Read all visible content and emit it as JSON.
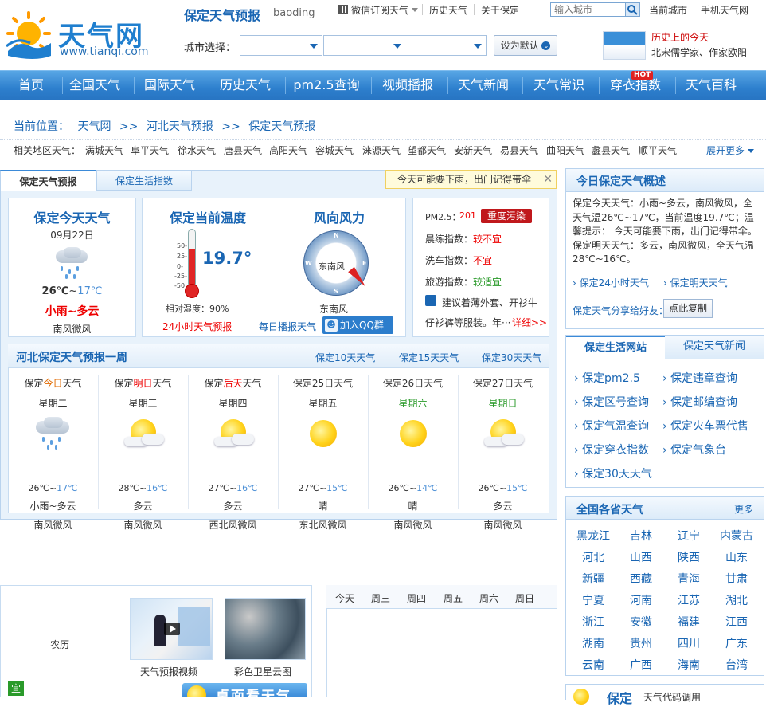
{
  "header": {
    "logo_text": "天气网",
    "logo_url": "www.tianqi.com",
    "page_title": "保定天气预报",
    "page_title_en": "baoding",
    "top_links": [
      "微信订阅天气",
      "历史天气",
      "关于保定"
    ],
    "search_placeholder": "输入城市",
    "current_city": "当前城市",
    "mobile_weather": "手机天气网",
    "city_select_label": "城市选择：",
    "set_default": "设为默认",
    "history_today_title": "历史上的今天",
    "history_today_desc": "北宋儒学家、作家欧阳"
  },
  "nav": {
    "items": [
      "首页",
      "全国天气",
      "国际天气",
      "历史天气",
      "pm2.5查询",
      "视频播报",
      "天气新闻",
      "天气常识",
      "穿衣指数",
      "天气百科"
    ],
    "hot_badge": "HOT"
  },
  "breadcrumb": {
    "label": "当前位置：",
    "items": [
      "天气网",
      "河北天气预报",
      "保定天气预报"
    ],
    "sep": ">>"
  },
  "related": {
    "label": "相关地区天气：",
    "items": [
      "满城天气",
      "阜平天气",
      "徐水天气",
      "唐县天气",
      "高阳天气",
      "容城天气",
      "涞源天气",
      "望都天气",
      "安新天气",
      "易县天气",
      "曲阳天气",
      "蠡县天气",
      "顺平天气"
    ],
    "expand": "展开更多"
  },
  "tabs": {
    "forecast": "保定天气预报",
    "life": "保定生活指数"
  },
  "alert": "今天可能要下雨，出门记得带伞",
  "today": {
    "title": "保定今天天气",
    "date": "09月22日",
    "temp_high": "26℃",
    "tilde": "~",
    "temp_low": "17℃",
    "condition": "小雨~多云",
    "wind": "南风微风"
  },
  "current": {
    "title": "保定当前温度",
    "temp": "19.7°",
    "temp_fraction": 0.66,
    "ticks": [
      "50-",
      "25-",
      "0-",
      "-25-",
      "-50"
    ],
    "humidity": "相对湿度：90%",
    "hourly_link": "24小时天气预报",
    "wind_title": "风向风力",
    "wind_dir": "东南风",
    "wind_bottom": "东南风",
    "compass": [
      "N",
      "E",
      "S",
      "W"
    ],
    "broadcast": "每日播报天气",
    "qq_group": "加入QQ群"
  },
  "indices": {
    "pm25_label": "PM2.5：",
    "pm25_value": "201",
    "pm25_level": "重度污染",
    "items": [
      {
        "label": "晨练指数：",
        "value": "较不宜"
      },
      {
        "label": "洗车指数：",
        "value": "不宜"
      },
      {
        "label": "旅游指数：",
        "value": "较适宜"
      }
    ],
    "advice_line1": "建议着薄外套、开衫牛",
    "advice_line2": "仔衫裤等服装。年···",
    "detail": "详细>>"
  },
  "week": {
    "title": "河北保定天气预报一周",
    "links": [
      "保定10天天气",
      "保定15天天气",
      "保定30天天气"
    ],
    "days": [
      {
        "pre": "保定",
        "hl": "今日",
        "post": "天气",
        "hl_class": "orange",
        "weekday": "星期二",
        "wk_class": "",
        "high": "26℃",
        "low": "17℃",
        "cond": "小雨~多云",
        "wind": "南风微风",
        "icon": "rain"
      },
      {
        "pre": "保定",
        "hl": "明日",
        "post": "天气",
        "hl_class": "red",
        "weekday": "星期三",
        "wk_class": "",
        "high": "28℃",
        "low": "16℃",
        "cond": "多云",
        "wind": "南风微风",
        "icon": "cloudy"
      },
      {
        "pre": "保定",
        "hl": "后天",
        "post": "天气",
        "hl_class": "red",
        "weekday": "星期四",
        "wk_class": "",
        "high": "27℃",
        "low": "16℃",
        "cond": "多云",
        "wind": "西北风微风",
        "icon": "cloudy"
      },
      {
        "pre": "保定",
        "hl": "25日",
        "post": "天气",
        "hl_class": "",
        "weekday": "星期五",
        "wk_class": "",
        "high": "27℃",
        "low": "15℃",
        "cond": "晴",
        "wind": "东北风微风",
        "icon": "sunny"
      },
      {
        "pre": "保定",
        "hl": "26日",
        "post": "天气",
        "hl_class": "",
        "weekday": "星期六",
        "wk_class": "green",
        "high": "26℃",
        "low": "14℃",
        "cond": "晴",
        "wind": "南风微风",
        "icon": "sunny"
      },
      {
        "pre": "保定",
        "hl": "27日",
        "post": "天气",
        "hl_class": "",
        "weekday": "星期日",
        "wk_class": "green",
        "high": "26℃",
        "low": "15℃",
        "cond": "多云",
        "wind": "南风微风",
        "icon": "cloudy"
      }
    ]
  },
  "summary": {
    "title": "今日保定天气概述",
    "text": "保定今天天气：小雨~多云，南风微风，全天气温26℃~17℃，当前温度19.7℃；温馨提示： 今天可能要下雨，出门记得带伞。保定明天天气：多云，南风微风，全天气温28℃~16℃。",
    "link1": "保定24小时天气",
    "link2": "保定明天天气",
    "share_label": "保定天气分享给好友：",
    "copy": "点此复制"
  },
  "life_box": {
    "tab1": "保定生活网站",
    "tab2": "保定天气新闻",
    "items": [
      "保定pm2.5",
      "保定违章查询",
      "保定区号查询",
      "保定邮编查询",
      "保定气温查询",
      "保定火车票代售",
      "保定穿衣指数",
      "保定气象台",
      "保定30天天气"
    ]
  },
  "provinces": {
    "title": "全国各省天气",
    "more": "更多",
    "items": [
      "黑龙江",
      "吉林",
      "辽宁",
      "内蒙古",
      "河北",
      "山西",
      "陕西",
      "山东",
      "新疆",
      "西藏",
      "青海",
      "甘肃",
      "宁夏",
      "河南",
      "江苏",
      "湖北",
      "浙江",
      "安徽",
      "福建",
      "江西",
      "湖南",
      "贵州",
      "四川",
      "广东",
      "云南",
      "广西",
      "海南",
      "台湾"
    ]
  },
  "bottom": {
    "lunar": "农历",
    "yi": "宜",
    "video_label": "天气预报视频",
    "satellite_label": "彩色卫星云图",
    "desktop_banner": "桌面看天气",
    "cal_days": [
      "今天",
      "周三",
      "周四",
      "周五",
      "周六",
      "周日"
    ],
    "footer_city": "保定",
    "footer_text": "天气代码调用"
  },
  "colors": {
    "brand_blue": "#1a66b3",
    "nav_blue": "#2d7fcd",
    "alert_red": "#e00000",
    "pollution_badge": "#c0181c"
  }
}
